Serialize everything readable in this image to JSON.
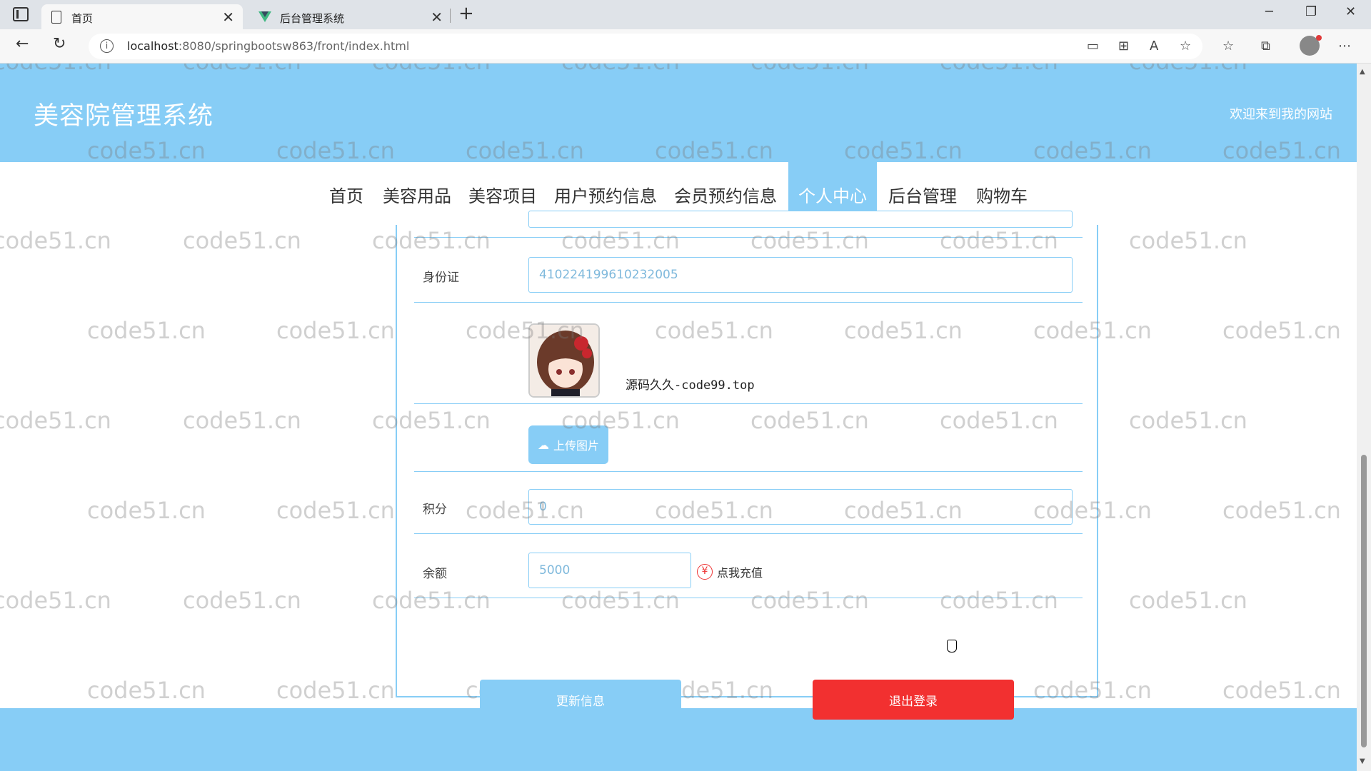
{
  "browser": {
    "tabs": [
      {
        "label": "首页",
        "icon": "document-icon",
        "active": true
      },
      {
        "label": "后台管理系统",
        "icon": "vue-logo-icon",
        "active": false
      }
    ],
    "new_tab_symbol": "+",
    "window_controls": {
      "minimize": "─",
      "restore": "❐",
      "close": "✕"
    },
    "nav": {
      "back": "←",
      "reload": "↻"
    },
    "url": {
      "host": "localhost",
      "rest": ":8080/springbootsw863/front/index.html"
    },
    "toolbar_icons": [
      "▭",
      "⊞",
      "A",
      "☆",
      "☆",
      "⧉",
      "⋯"
    ]
  },
  "site": {
    "title": "美容院管理系统",
    "welcome": "欢迎来到我的网站"
  },
  "nav": {
    "items": [
      "首页",
      "美容用品",
      "美容项目",
      "用户预约信息",
      "会员预约信息",
      "个人中心",
      "后台管理",
      "购物车"
    ],
    "active_index": 5
  },
  "form": {
    "id_card": {
      "label": "身份证",
      "value": "410224199610232005"
    },
    "avatar_caption": "源码久久-code99.top",
    "upload_label": "上传图片",
    "points": {
      "label": "积分",
      "value": "0"
    },
    "balance": {
      "label": "余额",
      "value": "5000"
    },
    "recharge_label": "点我充值",
    "recharge_icon": "¥",
    "update_button": "更新信息",
    "logout_button": "退出登录"
  },
  "watermark": "code51.cn",
  "colors": {
    "theme": "#87cdf6",
    "logout": "#f23030"
  }
}
